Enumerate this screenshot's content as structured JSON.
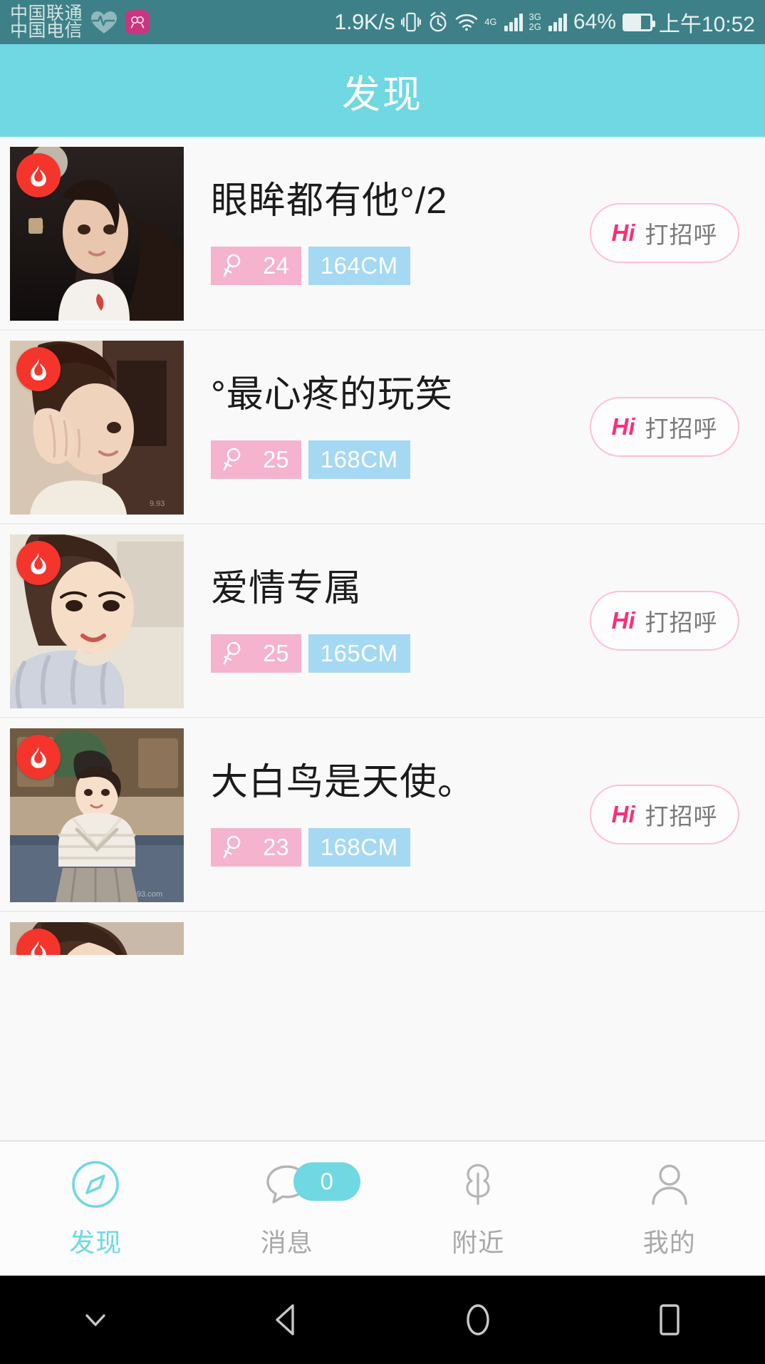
{
  "status_bar": {
    "carrier_primary": "中国联通",
    "carrier_secondary": "中国电信",
    "network_speed": "1.9K/s",
    "network_4g": "4G",
    "network_3g": "3G",
    "network_2g": "2G",
    "battery_percent": "64%",
    "clock": "上午10:52",
    "icons": [
      "heart-rate-icon",
      "app-badge-icon",
      "vibrate-icon",
      "alarm-icon",
      "wifi-icon",
      "signal-icon",
      "battery-icon"
    ]
  },
  "header": {
    "title": "发现"
  },
  "list": {
    "items": [
      {
        "nickname": "眼眸都有他°/2",
        "age": "24",
        "height": "164CM",
        "hot": true,
        "hi_prefix": "Hi",
        "hi_label": "打招呼",
        "photo_alt": "profile-photo"
      },
      {
        "nickname": "°最心疼的玩笑",
        "age": "25",
        "height": "168CM",
        "hot": true,
        "hi_prefix": "Hi",
        "hi_label": "打招呼",
        "photo_alt": "profile-photo"
      },
      {
        "nickname": "爱情专属",
        "age": "25",
        "height": "165CM",
        "hot": true,
        "hi_prefix": "Hi",
        "hi_label": "打招呼",
        "photo_alt": "profile-photo"
      },
      {
        "nickname": "大白鸟是天使。",
        "age": "23",
        "height": "168CM",
        "hot": true,
        "hi_prefix": "Hi",
        "hi_label": "打招呼",
        "photo_alt": "profile-photo"
      }
    ]
  },
  "tabbar": {
    "tabs": [
      {
        "label": "发现",
        "icon": "compass-icon",
        "active": true
      },
      {
        "label": "消息",
        "icon": "chat-bubble-icon",
        "active": false,
        "badge": "0"
      },
      {
        "label": "附近",
        "icon": "tree-icon",
        "active": false
      },
      {
        "label": "我的",
        "icon": "person-icon",
        "active": false
      }
    ]
  },
  "android_nav": {
    "buttons": [
      {
        "icon": "hide-keyboard-icon"
      },
      {
        "icon": "back-icon"
      },
      {
        "icon": "home-icon"
      },
      {
        "icon": "recents-icon"
      }
    ]
  },
  "colors": {
    "status_bar_bg": "#3e8087",
    "appbar_bg": "#6fd8e2",
    "accent_cyan": "#6fd8e2",
    "tag_pink": "#f5b3cd",
    "tag_blue": "#a5d8f3",
    "hi_pink": "#ff2d7a",
    "hot_red": "#f5342c"
  }
}
